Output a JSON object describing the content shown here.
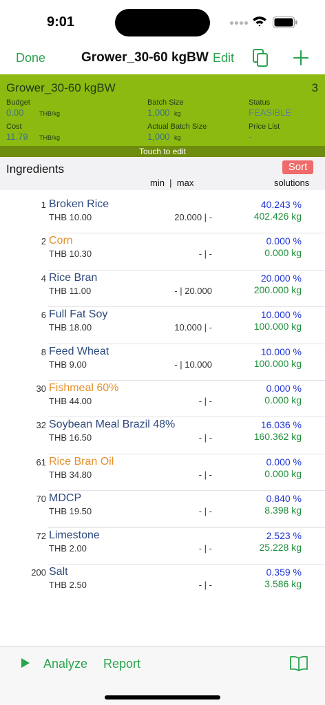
{
  "status_bar": {
    "time": "9:01"
  },
  "nav": {
    "done_label": "Done",
    "title": "Grower_30-60 kgBW",
    "edit_label": "Edit"
  },
  "header": {
    "name": "Grower_30-60 kgBW",
    "count": "3",
    "budget_label": "Budget",
    "budget_value": "0.00",
    "budget_unit": "THB/kg",
    "batch_size_label": "Batch Size",
    "batch_size_value": "1,000",
    "batch_size_unit": "kg",
    "status_label": "Status",
    "status_value": "FEASIBLE",
    "cost_label": "Cost",
    "cost_value": "11.79",
    "cost_unit": "THB/kg",
    "actual_batch_label": "Actual Batch Size",
    "actual_batch_value": "1,000",
    "actual_batch_unit": "kg",
    "price_list_label": "Price List",
    "price_list_value": "-",
    "touch_label": "Touch to edit"
  },
  "ingredients_header": {
    "title": "Ingredients",
    "sort_label": "Sort",
    "minmax_label": "min  |  max",
    "solutions_label": "solutions"
  },
  "ingredients": [
    {
      "code": "1",
      "name": "Broken Rice",
      "price": "THB 10.00",
      "minmax": "20.000 | -",
      "percent": "40.243 %",
      "kg": "402.426 kg",
      "color": "#2e4a7d"
    },
    {
      "code": "2",
      "name": "Corn",
      "price": "THB 10.30",
      "minmax": "- | -",
      "percent": "0.000 %",
      "kg": "0.000 kg",
      "color": "#e4902c"
    },
    {
      "code": "4",
      "name": "Rice Bran",
      "price": "THB 11.00",
      "minmax": "- | 20.000",
      "percent": "20.000 %",
      "kg": "200.000 kg",
      "color": "#2e4a7d"
    },
    {
      "code": "6",
      "name": "Full Fat Soy",
      "price": "THB 18.00",
      "minmax": "10.000 | -",
      "percent": "10.000 %",
      "kg": "100.000 kg",
      "color": "#2e4a7d"
    },
    {
      "code": "8",
      "name": "Feed Wheat",
      "price": "THB 9.00",
      "minmax": "- | 10.000",
      "percent": "10.000 %",
      "kg": "100.000 kg",
      "color": "#2e4a7d"
    },
    {
      "code": "30",
      "name": "Fishmeal 60%",
      "price": "THB 44.00",
      "minmax": "- | -",
      "percent": "0.000 %",
      "kg": "0.000 kg",
      "color": "#e4902c"
    },
    {
      "code": "32",
      "name": "Soybean Meal Brazil 48%",
      "price": "THB 16.50",
      "minmax": "- | -",
      "percent": "16.036 %",
      "kg": "160.362 kg",
      "color": "#2e4a7d"
    },
    {
      "code": "61",
      "name": "Rice Bran Oil",
      "price": "THB 34.80",
      "minmax": "- | -",
      "percent": "0.000 %",
      "kg": "0.000 kg",
      "color": "#e4902c"
    },
    {
      "code": "70",
      "name": "MDCP",
      "price": "THB 19.50",
      "minmax": "- | -",
      "percent": "0.840 %",
      "kg": "8.398 kg",
      "color": "#2e4a7d"
    },
    {
      "code": "72",
      "name": "Limestone",
      "price": "THB 2.00",
      "minmax": "- | -",
      "percent": "2.523 %",
      "kg": "25.228 kg",
      "color": "#2e4a7d"
    },
    {
      "code": "200",
      "name": "Salt",
      "price": "THB 2.50",
      "minmax": "- | -",
      "percent": "0.359 %",
      "kg": "3.586 kg",
      "color": "#2e4a7d"
    }
  ],
  "toolbar": {
    "analyze_label": "Analyze",
    "report_label": "Report"
  },
  "icons": {
    "copy": "copy-icon",
    "plus": "plus-icon",
    "play": "play-icon",
    "book": "book-icon",
    "wifi": "wifi-icon",
    "battery": "battery-icon"
  },
  "colors": {
    "accent": "#2aa44f",
    "header_bg": "#8cba10",
    "touch_bar_bg": "#6e8c0e",
    "sort_bg": "#ef6a6a",
    "percent": "#1f33d4",
    "kg": "#1e8f3a"
  }
}
